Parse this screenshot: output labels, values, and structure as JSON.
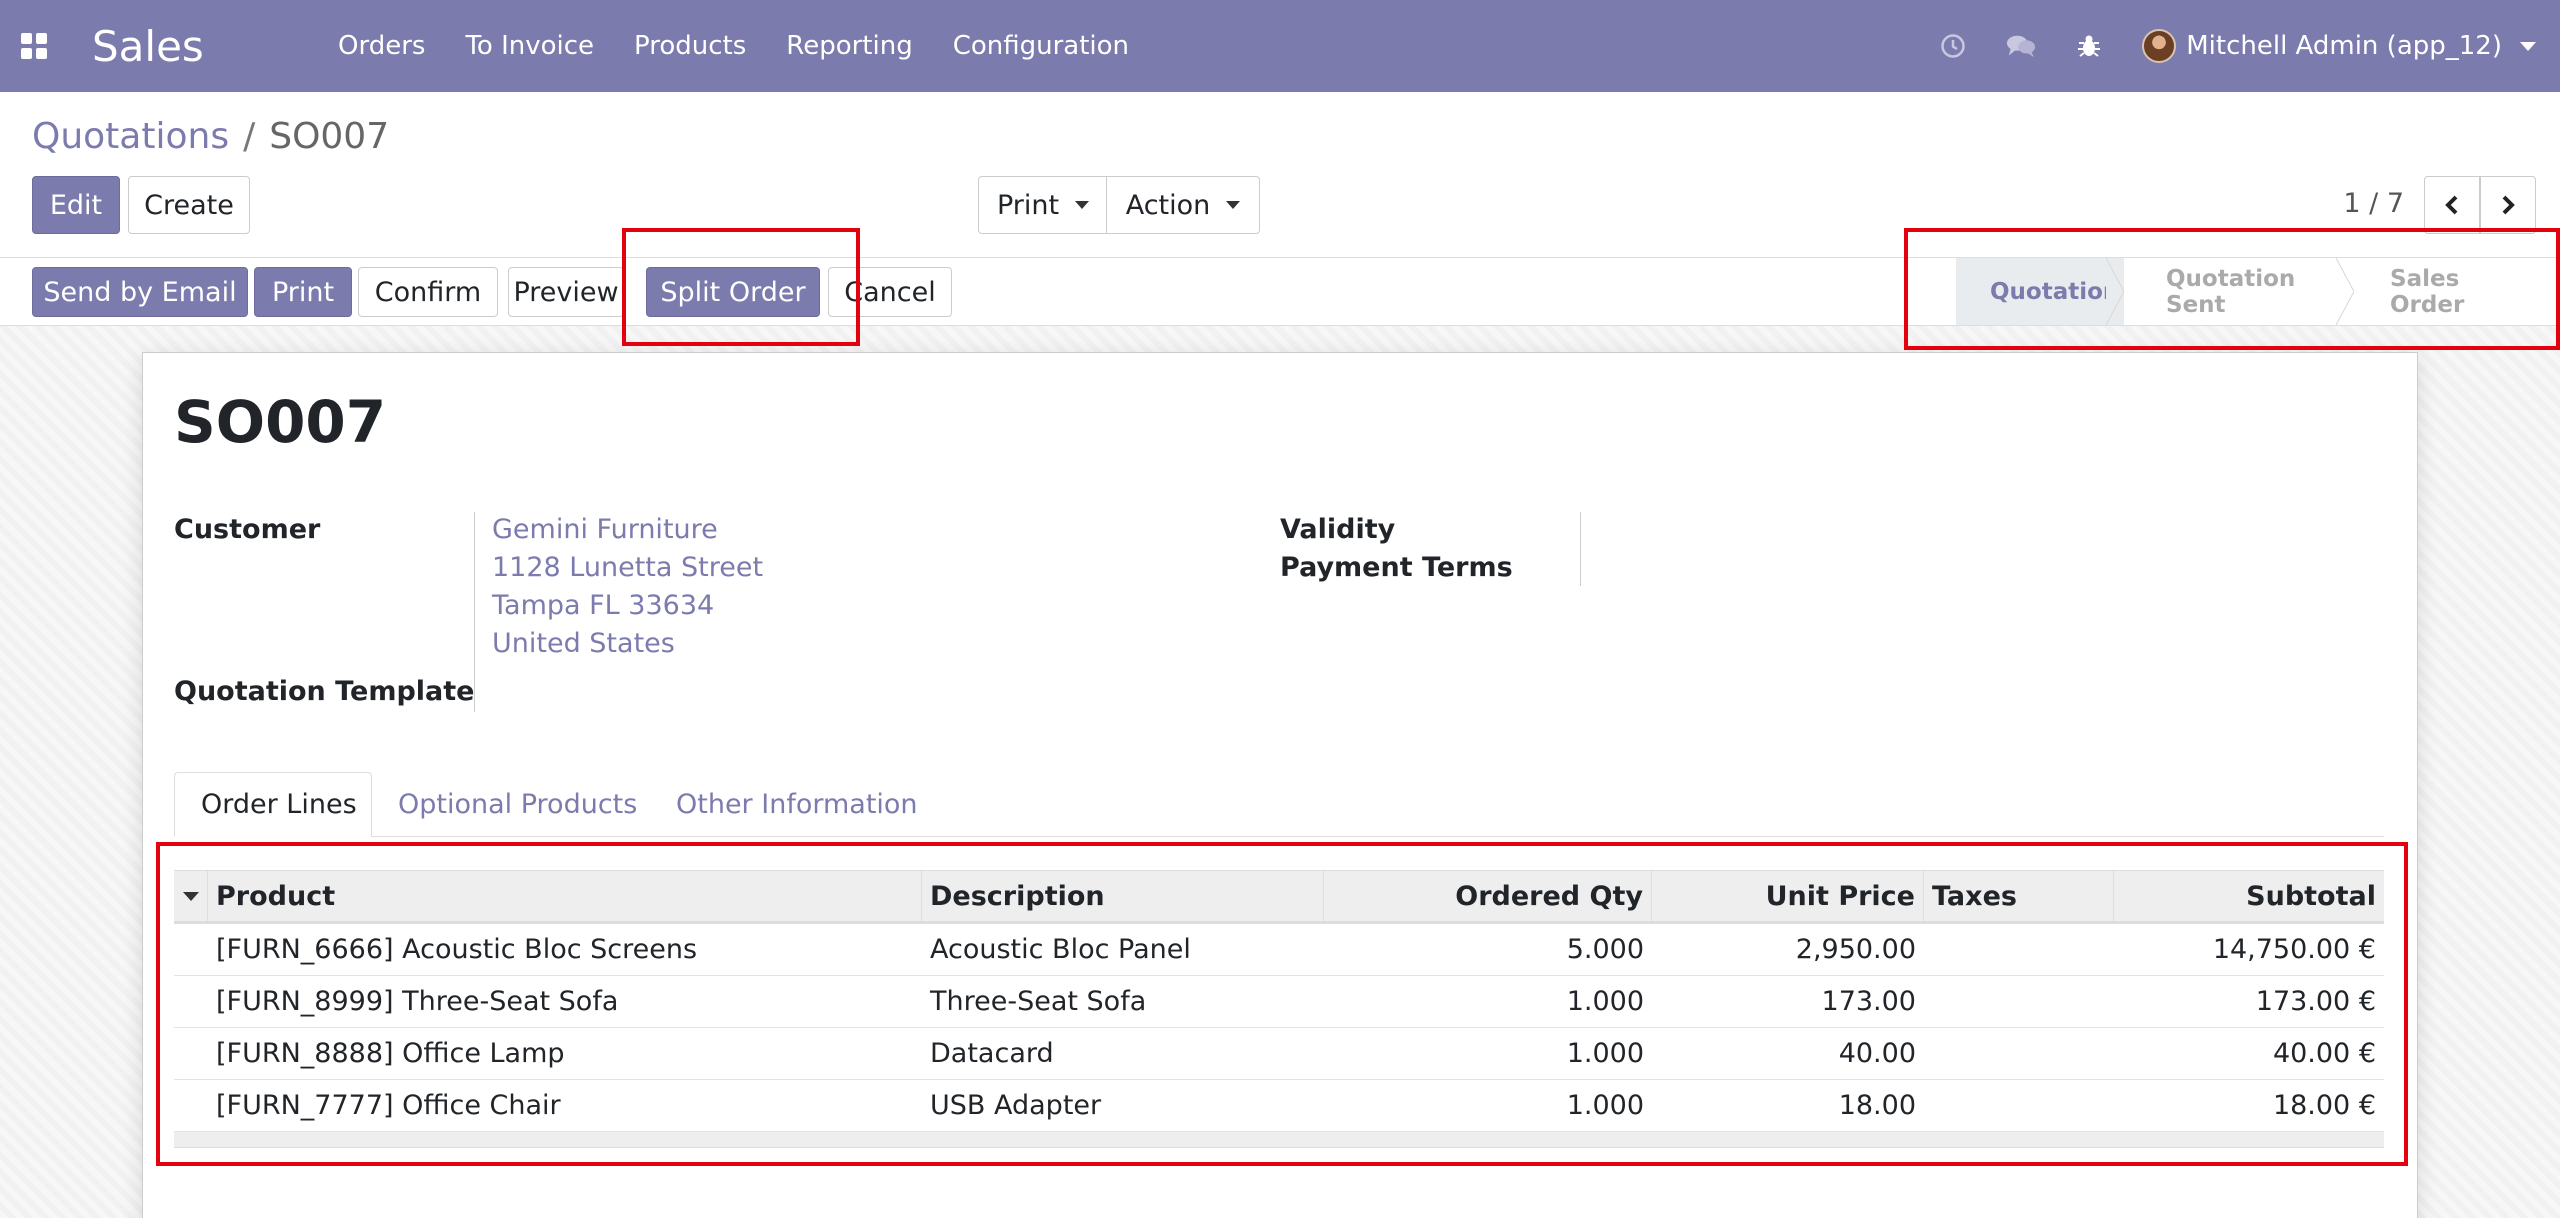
{
  "app": {
    "name": "Sales",
    "menu": [
      "Orders",
      "To Invoice",
      "Products",
      "Reporting",
      "Configuration"
    ],
    "icons": [
      "apps-grid-icon",
      "clock-icon",
      "chat-icon",
      "bug-icon"
    ],
    "user": "Mitchell Admin (app_12)"
  },
  "breadcrumb": {
    "parent": "Quotations",
    "separator": "/",
    "current": "SO007"
  },
  "control": {
    "edit_label": "Edit",
    "create_label": "Create",
    "print_label": "Print",
    "action_label": "Action",
    "pager": "1 / 7"
  },
  "statusbar": {
    "buttons": [
      "Send by Email",
      "Print",
      "Confirm",
      "Preview",
      "Split Order",
      "Cancel"
    ],
    "stages": [
      "Quotation",
      "Quotation Sent",
      "Sales Order"
    ],
    "active_stage": "Quotation"
  },
  "form": {
    "title": "SO007",
    "customer_label": "Customer",
    "customer_lines": [
      "Gemini Furniture",
      "1128 Lunetta Street",
      "Tampa FL 33634",
      "United States"
    ],
    "template_label": "Quotation Template",
    "validity_label": "Validity",
    "payment_terms_label": "Payment Terms"
  },
  "tabs": [
    "Order Lines",
    "Optional Products",
    "Other Information"
  ],
  "order_lines": {
    "columns": [
      "Product",
      "Description",
      "Ordered Qty",
      "Unit Price",
      "Taxes",
      "Subtotal"
    ],
    "rows": [
      [
        "[FURN_6666] Acoustic Bloc Screens",
        "Acoustic Bloc Panel",
        "5.000",
        "2,950.00",
        "",
        "14,750.00 €"
      ],
      [
        "[FURN_8999] Three-Seat Sofa",
        "Three-Seat Sofa",
        "1.000",
        "173.00",
        "",
        "173.00 €"
      ],
      [
        "[FURN_8888] Office Lamp",
        "Datacard",
        "1.000",
        "40.00",
        "",
        "40.00 €"
      ],
      [
        "[FURN_7777] Office Chair",
        "USB Adapter",
        "1.000",
        "18.00",
        "",
        "18.00 €"
      ]
    ]
  },
  "colors": {
    "brand": "#7c7bad",
    "highlight": "#e3000f"
  }
}
